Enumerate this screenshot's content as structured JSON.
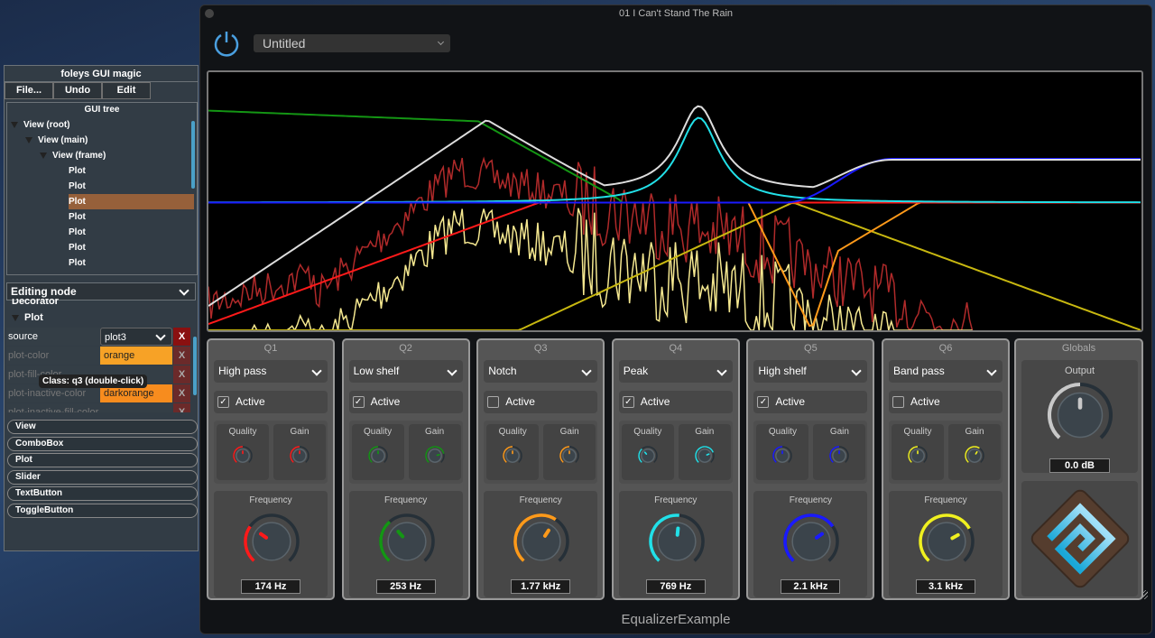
{
  "gui_magic": {
    "title": "foleys GUI magic",
    "buttons": [
      "File...",
      "Undo",
      "Edit"
    ],
    "tree_title": "GUI tree",
    "tree": [
      {
        "label": "View (root)",
        "level": 0,
        "expand": true
      },
      {
        "label": "View (main)",
        "level": 1,
        "expand": true
      },
      {
        "label": "View (frame)",
        "level": 2,
        "expand": true
      },
      {
        "label": "Plot",
        "level": 3
      },
      {
        "label": "Plot",
        "level": 3
      },
      {
        "label": "Plot",
        "level": 3,
        "selected": true
      },
      {
        "label": "Plot",
        "level": 3
      },
      {
        "label": "Plot",
        "level": 3
      },
      {
        "label": "Plot",
        "level": 3
      },
      {
        "label": "Plot",
        "level": 3
      }
    ],
    "editing_node": "Editing node",
    "section_decorator": "Decorator",
    "section_plot": "Plot",
    "properties": [
      {
        "key": "source",
        "value": "plot3",
        "combo": true,
        "active": true
      },
      {
        "key": "plot-color",
        "value": "orange",
        "color": "#f7a226"
      },
      {
        "key": "plot-fill-color",
        "value": ""
      },
      {
        "key": "plot-inactive-color",
        "value": "darkorange",
        "color": "#f78c1e"
      },
      {
        "key": "plot-inactive-fill-color",
        "value": ""
      }
    ],
    "remove_label": "X",
    "tooltip": "Class: q3 (double-click)",
    "palette": [
      "View",
      "ComboBox",
      "Plot",
      "Slider",
      "TextButton",
      "ToggleButton"
    ]
  },
  "window": {
    "title": "01 I Can't Stand The Rain",
    "preset": "Untitled",
    "footer": "EqualizerExample",
    "power_color": "#4a9fe0"
  },
  "bands": [
    {
      "title": "Q1",
      "type": "High pass",
      "active": true,
      "color": "#ff1a1a",
      "quality": 0.5,
      "gain": 0.5,
      "frequency": 0.3,
      "value": "174 Hz"
    },
    {
      "title": "Q2",
      "type": "Low shelf",
      "active": true,
      "color": "#149614",
      "quality": 0.5,
      "gain": 0.78,
      "frequency": 0.35,
      "value": "253 Hz"
    },
    {
      "title": "Q3",
      "type": "Notch",
      "active": false,
      "color": "#ff9a1a",
      "quality": 0.5,
      "gain": 0.5,
      "frequency": 0.62,
      "value": "1.77 kHz"
    },
    {
      "title": "Q4",
      "type": "Peak",
      "active": true,
      "color": "#22e0e8",
      "quality": 0.35,
      "gain": 0.75,
      "frequency": 0.52,
      "value": "769 Hz"
    },
    {
      "title": "Q5",
      "type": "High shelf",
      "active": true,
      "color": "#1a1aff",
      "quality": 0.5,
      "gain": 0.5,
      "frequency": 0.7,
      "value": "2.1 kHz"
    },
    {
      "title": "Q6",
      "type": "Band pass",
      "active": false,
      "color": "#f0f020",
      "quality": 0.5,
      "gain": 0.62,
      "frequency": 0.72,
      "value": "3.1 kHz"
    }
  ],
  "labels": {
    "active": "Active",
    "quality": "Quality",
    "gain": "Gain",
    "frequency": "Frequency",
    "check": "✓"
  },
  "globals": {
    "title": "Globals",
    "output_label": "Output",
    "output": 0.5,
    "output_value": "0.0 dB"
  }
}
